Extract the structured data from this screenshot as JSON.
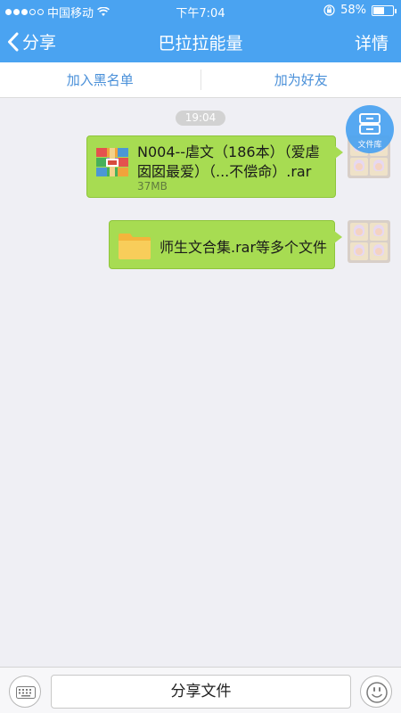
{
  "status_bar": {
    "carrier": "中国移动",
    "time": "下午7:04",
    "battery": "58%",
    "battery_level": 0.58
  },
  "nav": {
    "back_label": "分享",
    "title": "巴拉拉能量",
    "detail_label": "详情"
  },
  "actions": {
    "blacklist_label": "加入黑名单",
    "add_friend_label": "加为好友"
  },
  "chat": {
    "timestamp": "19:04",
    "file_library_label": "文件库",
    "messages": [
      {
        "file_name": "N004--虐文（186本）（爱虐囡囡最爱）（...不偿命）.rar",
        "file_size": "37MB",
        "icon": "rar-archive-icon"
      },
      {
        "file_name": "师生文合集.rar等多个文件",
        "icon": "folder-icon"
      }
    ]
  },
  "bottom_bar": {
    "share_label": "分享文件",
    "keyboard_icon": "keyboard-icon",
    "emoji_icon": "emoji-icon"
  },
  "colors": {
    "header_blue": "#4aa3f1",
    "bubble_green": "#a7dc52",
    "link_blue": "#4a90d9",
    "background": "#efeff4"
  }
}
